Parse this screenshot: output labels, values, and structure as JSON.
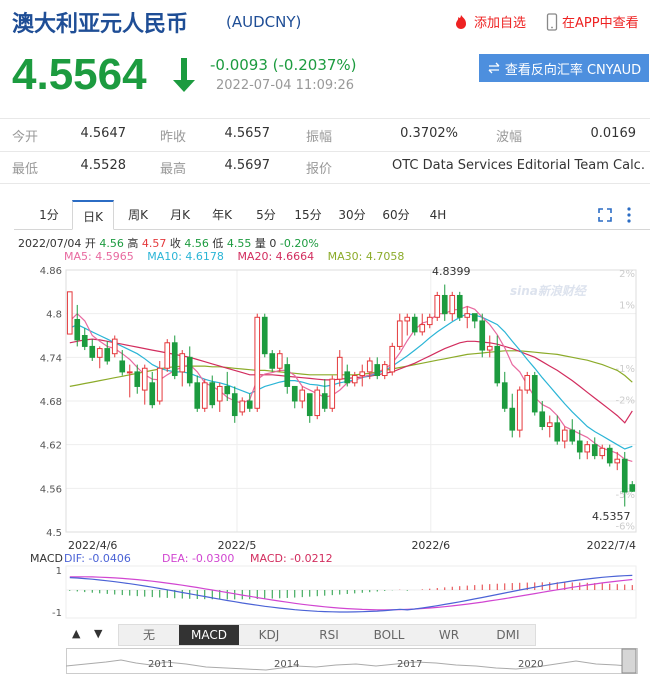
{
  "header": {
    "title": "澳大利亚元人民币",
    "code": "(AUDCNY)",
    "add_watch": "添加自选",
    "app_view": "在APP中查看"
  },
  "quote": {
    "price": "4.5564",
    "change": "-0.0093 (-0.2037%)",
    "time": "2022-07-04 11:09:26",
    "reverse_button": "查看反向汇率 CNYAUD"
  },
  "stats": [
    {
      "label": "今开",
      "value": "4.5647"
    },
    {
      "label": "昨收",
      "value": "4.5657"
    },
    {
      "label": "振幅",
      "value": "0.3702%"
    },
    {
      "label": "波幅",
      "value": "0.0169"
    },
    {
      "label": "最低",
      "value": "4.5528"
    },
    {
      "label": "最高",
      "value": "4.5697"
    },
    {
      "label": "报价",
      "value": "OTC Data Services Editorial Team Calc..."
    }
  ],
  "period_tabs": [
    "1分",
    "日K",
    "周K",
    "月K",
    "年K",
    "5分",
    "15分",
    "30分",
    "60分",
    "4H"
  ],
  "active_period": "日K",
  "info_line": {
    "date": "2022/07/04",
    "open_label": "开",
    "open": "4.56",
    "high_label": "高",
    "high": "4.57",
    "close_label": "收",
    "close": "4.56",
    "low_label": "低",
    "low": "4.55",
    "vol_label": "量",
    "vol": "0",
    "pct": "-0.20%"
  },
  "ma_line": {
    "ma5": "MA5: 4.5965",
    "ma10": "MA10: 4.6178",
    "ma20": "MA20: 4.6664",
    "ma30": "MA30: 4.7058"
  },
  "macd_line": {
    "label": "MACD",
    "dif": "DIF: -0.0406",
    "dea": "DEA: -0.0300",
    "macd": "MACD: -0.0212"
  },
  "indicator_tabs": [
    "无",
    "MACD",
    "KDJ",
    "RSI",
    "BOLL",
    "WR",
    "DMI"
  ],
  "active_indicator": "MACD",
  "watermark": "sina新浪财经",
  "colors": {
    "up": "#e4393c",
    "down": "#1c9b3f",
    "ma5": "#e86aa0",
    "ma10": "#2bb5d6",
    "ma20": "#d22d5e",
    "ma30": "#8cab2a"
  },
  "chart_data": {
    "type": "candlestick",
    "y_ticks": [
      "4.86",
      "4.8",
      "4.74",
      "4.68",
      "4.62",
      "4.56",
      "4.5"
    ],
    "pct_ticks": [
      "2%",
      "1%",
      "-1%",
      "-2%",
      "-5%",
      "-6%"
    ],
    "x_ticks": [
      "2022/4/6",
      "2022/5",
      "2022/6",
      "2022/7/4"
    ],
    "ylim": [
      4.5,
      4.86
    ],
    "annotations": {
      "max": "4.8399",
      "min": "4.5357"
    },
    "candles": [
      [
        4.772,
        4.828,
        4.78,
        4.83
      ],
      [
        4.792,
        4.812,
        4.755,
        4.764
      ],
      [
        4.77,
        4.78,
        4.75,
        4.755
      ],
      [
        4.755,
        4.765,
        4.735,
        4.74
      ],
      [
        4.74,
        4.755,
        4.725,
        4.752
      ],
      [
        4.752,
        4.762,
        4.73,
        4.735
      ],
      [
        4.745,
        4.77,
        4.74,
        4.765
      ],
      [
        4.735,
        4.75,
        4.715,
        4.72
      ],
      [
        4.72,
        4.73,
        4.685,
        4.72
      ],
      [
        4.72,
        4.73,
        4.69,
        4.7
      ],
      [
        4.695,
        4.73,
        4.675,
        4.725
      ],
      [
        4.705,
        4.72,
        4.67,
        4.675
      ],
      [
        4.68,
        4.735,
        4.675,
        4.725
      ],
      [
        4.725,
        4.765,
        4.72,
        4.76
      ],
      [
        4.76,
        4.77,
        4.71,
        4.715
      ],
      [
        4.72,
        4.75,
        4.7,
        4.745
      ],
      [
        4.74,
        4.755,
        4.7,
        4.705
      ],
      [
        4.705,
        4.715,
        4.665,
        4.67
      ],
      [
        4.67,
        4.71,
        4.665,
        4.705
      ],
      [
        4.705,
        4.715,
        4.67,
        4.675
      ],
      [
        4.68,
        4.705,
        4.665,
        4.7
      ],
      [
        4.7,
        4.72,
        4.68,
        4.69
      ],
      [
        4.69,
        4.7,
        4.65,
        4.66
      ],
      [
        4.665,
        4.685,
        4.66,
        4.68
      ],
      [
        4.68,
        4.69,
        4.665,
        4.67
      ],
      [
        4.67,
        4.8,
        4.665,
        4.795
      ],
      [
        4.795,
        4.8,
        4.74,
        4.745
      ],
      [
        4.745,
        4.75,
        4.72,
        4.725
      ],
      [
        4.725,
        4.75,
        4.72,
        4.745
      ],
      [
        4.73,
        4.74,
        4.69,
        4.7
      ],
      [
        4.7,
        4.7,
        4.67,
        4.68
      ],
      [
        4.68,
        4.7,
        4.67,
        4.695
      ],
      [
        4.69,
        4.69,
        4.65,
        4.66
      ],
      [
        4.66,
        4.7,
        4.655,
        4.695
      ],
      [
        4.69,
        4.71,
        4.665,
        4.67
      ],
      [
        4.67,
        4.715,
        4.665,
        4.71
      ],
      [
        4.71,
        4.75,
        4.7,
        4.74
      ],
      [
        4.72,
        4.73,
        4.7,
        4.705
      ],
      [
        4.705,
        4.72,
        4.7,
        4.715
      ],
      [
        4.715,
        4.73,
        4.7,
        4.72
      ],
      [
        4.72,
        4.74,
        4.71,
        4.735
      ],
      [
        4.73,
        4.74,
        4.71,
        4.715
      ],
      [
        4.715,
        4.735,
        4.71,
        4.73
      ],
      [
        4.72,
        4.76,
        4.715,
        4.755
      ],
      [
        4.755,
        4.8,
        4.75,
        4.79
      ],
      [
        4.79,
        4.8,
        4.77,
        4.795
      ],
      [
        4.795,
        4.8,
        4.77,
        4.775
      ],
      [
        4.775,
        4.8,
        4.77,
        4.785
      ],
      [
        4.785,
        4.8,
        4.78,
        4.795
      ],
      [
        4.795,
        4.83,
        4.79,
        4.825
      ],
      [
        4.825,
        4.84,
        4.79,
        4.8
      ],
      [
        4.8,
        4.83,
        4.79,
        4.825
      ],
      [
        4.825,
        4.83,
        4.79,
        4.795
      ],
      [
        4.795,
        4.81,
        4.78,
        4.8
      ],
      [
        4.8,
        4.8,
        4.78,
        4.79
      ],
      [
        4.79,
        4.8,
        4.74,
        4.75
      ],
      [
        4.75,
        4.77,
        4.74,
        4.755
      ],
      [
        4.755,
        4.77,
        4.7,
        4.705
      ],
      [
        4.705,
        4.72,
        4.665,
        4.67
      ],
      [
        4.67,
        4.69,
        4.63,
        4.64
      ],
      [
        4.64,
        4.7,
        4.63,
        4.695
      ],
      [
        4.695,
        4.72,
        4.69,
        4.715
      ],
      [
        4.715,
        4.72,
        4.66,
        4.665
      ],
      [
        4.665,
        4.68,
        4.64,
        4.645
      ],
      [
        4.645,
        4.66,
        4.63,
        4.65
      ],
      [
        4.65,
        4.66,
        4.62,
        4.625
      ],
      [
        4.625,
        4.645,
        4.615,
        4.64
      ],
      [
        4.64,
        4.655,
        4.62,
        4.625
      ],
      [
        4.625,
        4.64,
        4.6,
        4.61
      ],
      [
        4.61,
        4.625,
        4.6,
        4.62
      ],
      [
        4.62,
        4.63,
        4.6,
        4.605
      ],
      [
        4.605,
        4.62,
        4.6,
        4.615
      ],
      [
        4.615,
        4.62,
        4.59,
        4.595
      ],
      [
        4.595,
        4.61,
        4.585,
        4.6
      ],
      [
        4.6,
        4.61,
        4.535,
        4.555
      ],
      [
        4.565,
        4.57,
        4.555,
        4.556
      ]
    ],
    "ma5": [
      4.79,
      4.8,
      4.79,
      4.77,
      4.762,
      4.755,
      4.752,
      4.745,
      4.737,
      4.726,
      4.716,
      4.71,
      4.709,
      4.716,
      4.722,
      4.727,
      4.73,
      4.72,
      4.705,
      4.7,
      4.694,
      4.685,
      4.68,
      4.677,
      4.682,
      4.71,
      4.717,
      4.719,
      4.722,
      4.722,
      4.715,
      4.7,
      4.695,
      4.69,
      4.685,
      4.688,
      4.695,
      4.705,
      4.708,
      4.713,
      4.716,
      4.72,
      4.724,
      4.732,
      4.746,
      4.763,
      4.778,
      4.787,
      4.79,
      4.8,
      4.8,
      4.805,
      4.806,
      4.81,
      4.806,
      4.795,
      4.785,
      4.771,
      4.753,
      4.73,
      4.72,
      4.702,
      4.685,
      4.675,
      4.67,
      4.66,
      4.645,
      4.64,
      4.635,
      4.63,
      4.622,
      4.615,
      4.612,
      4.608,
      4.6,
      4.597
    ],
    "ma10": [
      4.78,
      4.785,
      4.78,
      4.775,
      4.77,
      4.765,
      4.76,
      4.755,
      4.75,
      4.745,
      4.738,
      4.73,
      4.725,
      4.722,
      4.72,
      4.72,
      4.718,
      4.714,
      4.71,
      4.707,
      4.705,
      4.702,
      4.698,
      4.694,
      4.69,
      4.695,
      4.7,
      4.703,
      4.706,
      4.708,
      4.708,
      4.706,
      4.703,
      4.702,
      4.7,
      4.702,
      4.705,
      4.707,
      4.709,
      4.712,
      4.715,
      4.718,
      4.722,
      4.728,
      4.735,
      4.742,
      4.75,
      4.758,
      4.767,
      4.775,
      4.782,
      4.789,
      4.795,
      4.8,
      4.798,
      4.795,
      4.79,
      4.785,
      4.775,
      4.762,
      4.75,
      4.737,
      4.725,
      4.712,
      4.7,
      4.688,
      4.676,
      4.665,
      4.655,
      4.645,
      4.638,
      4.632,
      4.626,
      4.62,
      4.614,
      4.6178
    ],
    "ma20": [
      4.76,
      4.762,
      4.764,
      4.765,
      4.764,
      4.762,
      4.76,
      4.758,
      4.756,
      4.754,
      4.752,
      4.75,
      4.748,
      4.746,
      4.744,
      4.742,
      4.74,
      4.737,
      4.734,
      4.731,
      4.728,
      4.725,
      4.722,
      4.719,
      4.716,
      4.716,
      4.716,
      4.716,
      4.715,
      4.714,
      4.713,
      4.712,
      4.711,
      4.71,
      4.709,
      4.709,
      4.71,
      4.711,
      4.712,
      4.713,
      4.714,
      4.716,
      4.718,
      4.72,
      4.724,
      4.728,
      4.732,
      4.737,
      4.742,
      4.747,
      4.752,
      4.756,
      4.76,
      4.762,
      4.762,
      4.761,
      4.76,
      4.758,
      4.755,
      4.752,
      4.748,
      4.744,
      4.74,
      4.734,
      4.728,
      4.722,
      4.715,
      4.708,
      4.7,
      4.692,
      4.684,
      4.676,
      4.668,
      4.66,
      4.65,
      4.6664
    ],
    "ma30": [
      4.7,
      4.702,
      4.704,
      4.706,
      4.708,
      4.71,
      4.712,
      4.714,
      4.716,
      4.718,
      4.72,
      4.722,
      4.724,
      4.726,
      4.727,
      4.728,
      4.728,
      4.728,
      4.728,
      4.727,
      4.727,
      4.726,
      4.725,
      4.724,
      4.723,
      4.722,
      4.722,
      4.721,
      4.72,
      4.719,
      4.718,
      4.717,
      4.716,
      4.716,
      4.716,
      4.716,
      4.716,
      4.716,
      4.716,
      4.717,
      4.718,
      4.72,
      4.722,
      4.724,
      4.726,
      4.728,
      4.73,
      4.732,
      4.734,
      4.736,
      4.738,
      4.74,
      4.742,
      4.744,
      4.745,
      4.746,
      4.747,
      4.748,
      4.749,
      4.749,
      4.749,
      4.748,
      4.747,
      4.746,
      4.745,
      4.744,
      4.742,
      4.74,
      4.738,
      4.736,
      4.733,
      4.73,
      4.726,
      4.722,
      4.715,
      4.7058
    ]
  },
  "overview": {
    "years": [
      "2011",
      "2014",
      "2017",
      "2020"
    ]
  }
}
